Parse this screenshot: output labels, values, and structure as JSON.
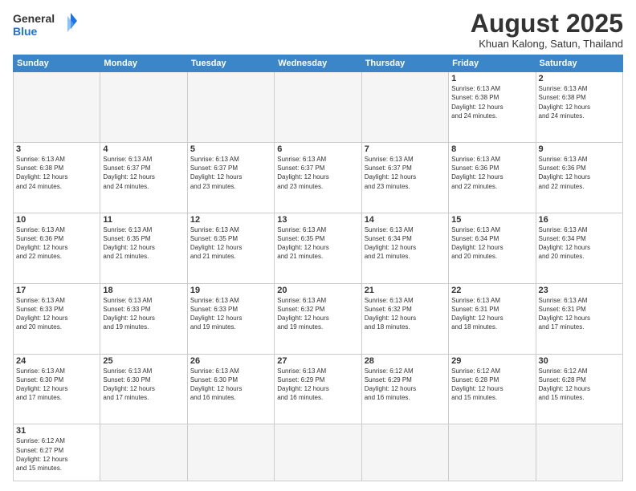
{
  "header": {
    "logo_general": "General",
    "logo_blue": "Blue",
    "month_title": "August 2025",
    "subtitle": "Khuan Kalong, Satun, Thailand"
  },
  "weekdays": [
    "Sunday",
    "Monday",
    "Tuesday",
    "Wednesday",
    "Thursday",
    "Friday",
    "Saturday"
  ],
  "weeks": [
    [
      {
        "day": "",
        "info": ""
      },
      {
        "day": "",
        "info": ""
      },
      {
        "day": "",
        "info": ""
      },
      {
        "day": "",
        "info": ""
      },
      {
        "day": "",
        "info": ""
      },
      {
        "day": "1",
        "info": "Sunrise: 6:13 AM\nSunset: 6:38 PM\nDaylight: 12 hours\nand 24 minutes."
      },
      {
        "day": "2",
        "info": "Sunrise: 6:13 AM\nSunset: 6:38 PM\nDaylight: 12 hours\nand 24 minutes."
      }
    ],
    [
      {
        "day": "3",
        "info": "Sunrise: 6:13 AM\nSunset: 6:38 PM\nDaylight: 12 hours\nand 24 minutes."
      },
      {
        "day": "4",
        "info": "Sunrise: 6:13 AM\nSunset: 6:37 PM\nDaylight: 12 hours\nand 24 minutes."
      },
      {
        "day": "5",
        "info": "Sunrise: 6:13 AM\nSunset: 6:37 PM\nDaylight: 12 hours\nand 23 minutes."
      },
      {
        "day": "6",
        "info": "Sunrise: 6:13 AM\nSunset: 6:37 PM\nDaylight: 12 hours\nand 23 minutes."
      },
      {
        "day": "7",
        "info": "Sunrise: 6:13 AM\nSunset: 6:37 PM\nDaylight: 12 hours\nand 23 minutes."
      },
      {
        "day": "8",
        "info": "Sunrise: 6:13 AM\nSunset: 6:36 PM\nDaylight: 12 hours\nand 22 minutes."
      },
      {
        "day": "9",
        "info": "Sunrise: 6:13 AM\nSunset: 6:36 PM\nDaylight: 12 hours\nand 22 minutes."
      }
    ],
    [
      {
        "day": "10",
        "info": "Sunrise: 6:13 AM\nSunset: 6:36 PM\nDaylight: 12 hours\nand 22 minutes."
      },
      {
        "day": "11",
        "info": "Sunrise: 6:13 AM\nSunset: 6:35 PM\nDaylight: 12 hours\nand 21 minutes."
      },
      {
        "day": "12",
        "info": "Sunrise: 6:13 AM\nSunset: 6:35 PM\nDaylight: 12 hours\nand 21 minutes."
      },
      {
        "day": "13",
        "info": "Sunrise: 6:13 AM\nSunset: 6:35 PM\nDaylight: 12 hours\nand 21 minutes."
      },
      {
        "day": "14",
        "info": "Sunrise: 6:13 AM\nSunset: 6:34 PM\nDaylight: 12 hours\nand 21 minutes."
      },
      {
        "day": "15",
        "info": "Sunrise: 6:13 AM\nSunset: 6:34 PM\nDaylight: 12 hours\nand 20 minutes."
      },
      {
        "day": "16",
        "info": "Sunrise: 6:13 AM\nSunset: 6:34 PM\nDaylight: 12 hours\nand 20 minutes."
      }
    ],
    [
      {
        "day": "17",
        "info": "Sunrise: 6:13 AM\nSunset: 6:33 PM\nDaylight: 12 hours\nand 20 minutes."
      },
      {
        "day": "18",
        "info": "Sunrise: 6:13 AM\nSunset: 6:33 PM\nDaylight: 12 hours\nand 19 minutes."
      },
      {
        "day": "19",
        "info": "Sunrise: 6:13 AM\nSunset: 6:33 PM\nDaylight: 12 hours\nand 19 minutes."
      },
      {
        "day": "20",
        "info": "Sunrise: 6:13 AM\nSunset: 6:32 PM\nDaylight: 12 hours\nand 19 minutes."
      },
      {
        "day": "21",
        "info": "Sunrise: 6:13 AM\nSunset: 6:32 PM\nDaylight: 12 hours\nand 18 minutes."
      },
      {
        "day": "22",
        "info": "Sunrise: 6:13 AM\nSunset: 6:31 PM\nDaylight: 12 hours\nand 18 minutes."
      },
      {
        "day": "23",
        "info": "Sunrise: 6:13 AM\nSunset: 6:31 PM\nDaylight: 12 hours\nand 17 minutes."
      }
    ],
    [
      {
        "day": "24",
        "info": "Sunrise: 6:13 AM\nSunset: 6:30 PM\nDaylight: 12 hours\nand 17 minutes."
      },
      {
        "day": "25",
        "info": "Sunrise: 6:13 AM\nSunset: 6:30 PM\nDaylight: 12 hours\nand 17 minutes."
      },
      {
        "day": "26",
        "info": "Sunrise: 6:13 AM\nSunset: 6:30 PM\nDaylight: 12 hours\nand 16 minutes."
      },
      {
        "day": "27",
        "info": "Sunrise: 6:13 AM\nSunset: 6:29 PM\nDaylight: 12 hours\nand 16 minutes."
      },
      {
        "day": "28",
        "info": "Sunrise: 6:12 AM\nSunset: 6:29 PM\nDaylight: 12 hours\nand 16 minutes."
      },
      {
        "day": "29",
        "info": "Sunrise: 6:12 AM\nSunset: 6:28 PM\nDaylight: 12 hours\nand 15 minutes."
      },
      {
        "day": "30",
        "info": "Sunrise: 6:12 AM\nSunset: 6:28 PM\nDaylight: 12 hours\nand 15 minutes."
      }
    ],
    [
      {
        "day": "31",
        "info": "Sunrise: 6:12 AM\nSunset: 6:27 PM\nDaylight: 12 hours\nand 15 minutes."
      },
      {
        "day": "",
        "info": ""
      },
      {
        "day": "",
        "info": ""
      },
      {
        "day": "",
        "info": ""
      },
      {
        "day": "",
        "info": ""
      },
      {
        "day": "",
        "info": ""
      },
      {
        "day": "",
        "info": ""
      }
    ]
  ]
}
